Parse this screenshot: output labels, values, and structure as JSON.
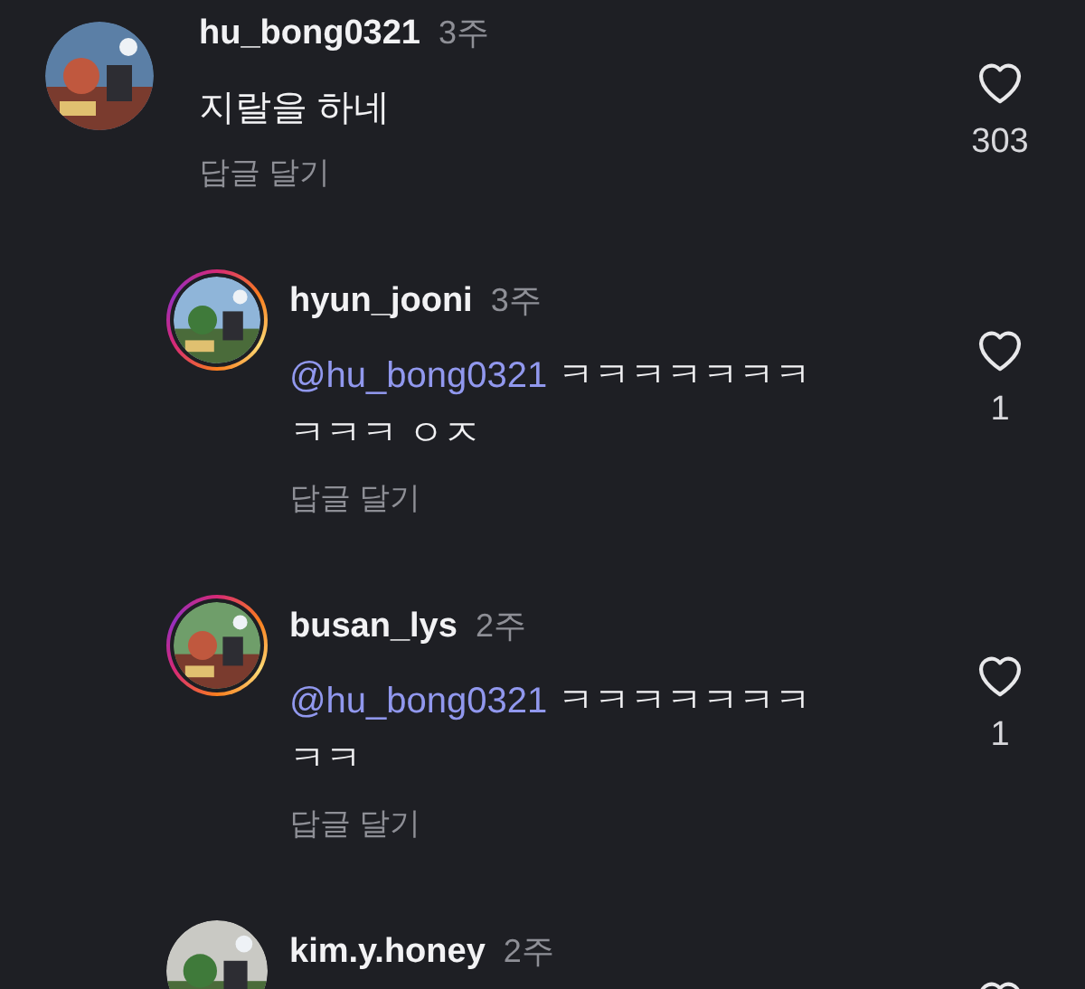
{
  "comments": [
    {
      "username": "hu_bong0321",
      "time": "3주",
      "avatar": {
        "ring": false,
        "kind": "picture"
      },
      "body": {
        "lines": [
          "지랄을 하네"
        ]
      },
      "reply_label": "답글 달기",
      "liked": false,
      "likes": "303",
      "children": [
        {
          "username": "hyun_jooni",
          "time": "3주",
          "avatar": {
            "ring": true,
            "kind": "picture"
          },
          "body": {
            "mention": "@hu_bong0321",
            "lines": [
              "ㅋㅋㅋㅋㅋㅋㅋ",
              "ㅋㅋㅋ ㅇㅈ"
            ]
          },
          "reply_label": "답글 달기",
          "liked": false,
          "likes": "1"
        },
        {
          "username": "busan_lys",
          "time": "2주",
          "avatar": {
            "ring": true,
            "kind": "picture"
          },
          "body": {
            "mention": "@hu_bong0321",
            "lines": [
              "ㅋㅋㅋㅋㅋㅋㅋ",
              "ㅋㅋ"
            ]
          },
          "reply_label": "답글 달기",
          "liked": false,
          "likes": "1"
        },
        {
          "username": "kim.y.honey",
          "time": "2주",
          "avatar": {
            "ring": false,
            "kind": "picture"
          },
          "liked": false
        }
      ]
    }
  ]
}
